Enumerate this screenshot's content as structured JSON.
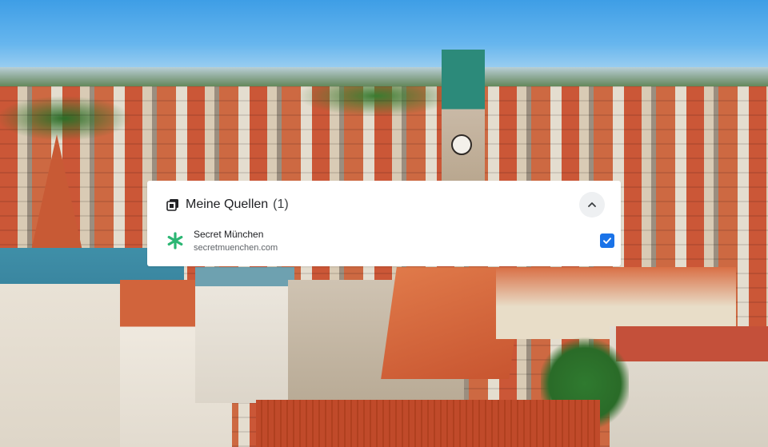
{
  "background": {
    "description_icon": "city-photo"
  },
  "card": {
    "header_icon": "stacked-sources-icon",
    "title": "Meine Quellen",
    "count": "(1)",
    "collapse_icon": "chevron-up-icon",
    "sources": [
      {
        "name": "Secret München",
        "url": "secretmuenchen.com",
        "icon": "asterisk-green-icon",
        "checked": true
      }
    ]
  },
  "colors": {
    "accent_checkbox": "#1a73e8",
    "source_icon": "#2bb673"
  }
}
